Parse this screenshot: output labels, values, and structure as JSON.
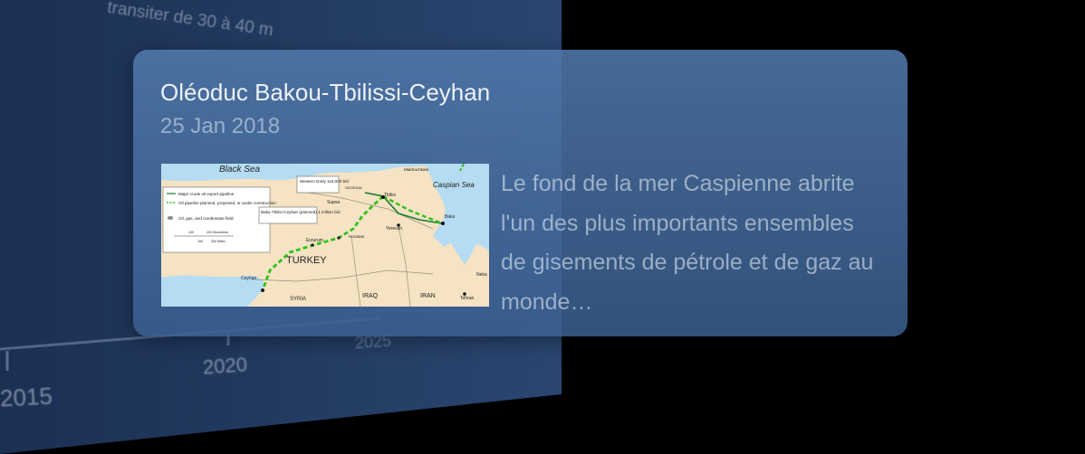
{
  "background": {
    "caption": "transiter de 30 à 40 m",
    "axis_ticks": [
      "2015",
      "2020",
      "2025"
    ]
  },
  "card": {
    "title": "Oléoduc Bakou-Tbilissi-Ceyhan",
    "date": "25 Jan 2018",
    "excerpt": "Le fond de la mer Caspienne abrite l'un des plus importants ensembles de gisements de pétrole et de gaz au monde…",
    "map": {
      "seas": [
        "Black Sea",
        "Caspian Sea"
      ],
      "countries": [
        "TURKEY",
        "SYRIA",
        "IRAQ",
        "IRAN",
        "GEORGIA"
      ],
      "cities": [
        "Tbilisi",
        "Baku",
        "Yerevan",
        "Ceyhan",
        "Erzurum",
        "Supsa",
        "Makhachkala",
        "Tehran",
        "Horasan",
        "Neka"
      ],
      "legend": [
        "Major crude oil export pipeline",
        "Oil pipeline planned, proposed, or under construction",
        "Oil, gas, and condensate field"
      ],
      "scale": [
        "100",
        "200 Kilometers",
        "100",
        "200 Miles"
      ],
      "callouts": [
        "Western Early 115,000 b/d",
        "Baku-Tbilisi-Ceyhan (planned) 1 million b/d"
      ],
      "colors": {
        "land": "#f5e3c3",
        "sea": "#b5dcf2",
        "planned_pipeline": "#2fc21b",
        "existing_pipeline": "#1a7a30"
      }
    }
  },
  "colors": {
    "page_bg": "#000000",
    "card_bg": "#4f77aa",
    "title": "#ecf1f7"
  }
}
